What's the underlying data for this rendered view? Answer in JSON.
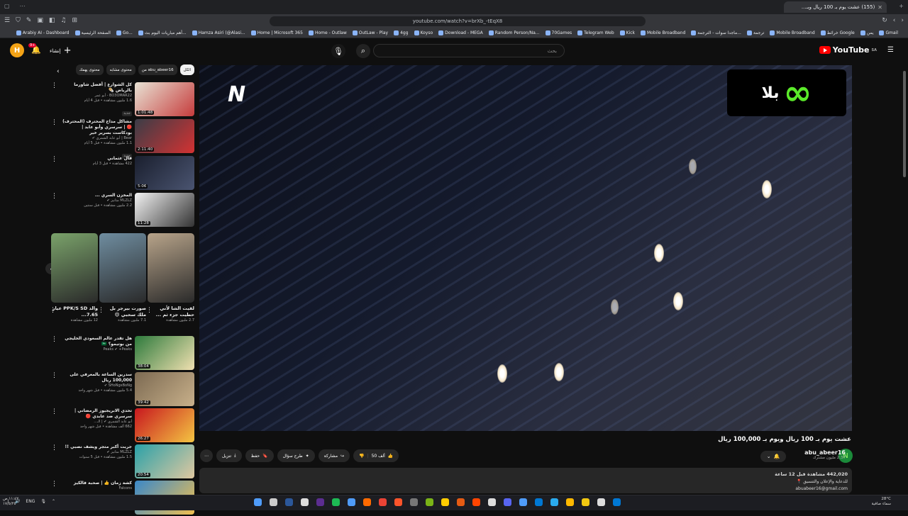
{
  "browser": {
    "tab_title": "(155) عشت يوم بـ 100 ريال وبـ...",
    "url": "youtube.com/watch?v=brXb_-tEqX8",
    "bookmarks": [
      "Gmail",
      "يمن",
      "خرائط Google",
      "Mobile Broadband",
      "ترجمة",
      "ماجدا سوات - الترجمة...",
      "Mobile Broadband",
      "Kick",
      "Telegram Web",
      "70Games",
      "Random Person/Na...",
      "Download - MEGA",
      "Koyso",
      "4gg",
      "OutLaw - Play",
      "Home - Outlaw",
      "Home | Microsoft 365",
      "Hamza Asiri (@Alasi...",
      "أهم مباريات اليوم بث...",
      "Go...",
      "الصفحة الرئيسية",
      "Arabiy AI - Dashboard"
    ]
  },
  "masthead": {
    "logo_text": "YouTube",
    "logo_region": "SA",
    "search_placeholder": "بحث",
    "create_label": "إنشاء",
    "notif_count": "9+",
    "profile_initial": "H"
  },
  "player": {
    "channel_watermark": "∞",
    "channel_watermark_ar": "بلا"
  },
  "video": {
    "title": "عشت يوم بـ 100 ريال ويوم بـ 100,000 ريال",
    "channel": "abu_abeer16",
    "subs": "2.37 مليون مشترك",
    "likes": "50 ألف",
    "share": "مشاركة",
    "ask": "طرح سؤال",
    "save": "حفظ",
    "download": "تنزيل",
    "views_line": "442,020 مشاهدة قبل 12 ساعة",
    "desc_line1": "للدعاية والإعلان والتنسيق 📍",
    "desc_line2": "abuabeer16@gmail.com"
  },
  "chips": [
    "من abu_abeer16",
    "محتوى مشابه",
    "محتوى يهمك"
  ],
  "chip_all": "الكل",
  "sidebar": [
    {
      "title": "كل الشوارع | أفضل شاورما بالرياض 🌯",
      "channel": "BO3OMAR22 - أبو عمر",
      "meta": "1.6 مليون مشاهدة • قبل 4 أيام",
      "badge": "جديد",
      "duration": "1:01:48",
      "color1": "#e8e2d4",
      "color2": "#c63c3c"
    },
    {
      "title": "مشاكل مداح المحترف (المحترف) 🔴 | سرسري وأبو عابد | بودكاست بسرير خير",
      "channel": "Bear | أبو عابد الشمري ✔",
      "meta": "1.1 مليون مشاهدة • قبل 5 أيام",
      "badge": "جديد",
      "duration": "2:11:40",
      "color1": "#3a3d47",
      "color2": "#d43232"
    },
    {
      "title": "قال عثماني",
      "channel": "",
      "meta": "422 مشاهدة • قبل 3 أيام",
      "badge": "",
      "duration": "5:06",
      "color1": "#1a1f2e",
      "color2": "#4a5470"
    },
    {
      "title": "المخزن السري ...",
      "channel": "MLZLZ مثانيز ✔",
      "meta": "2.2 مليون مشاهدة • قبل سنتين",
      "badge": "",
      "duration": "11:28",
      "color1": "#f2f2f2",
      "color2": "#333333"
    }
  ],
  "shorts": [
    {
      "title": "لقيت الشا لأني حطيت جزء ثم ...",
      "meta": "2.7 مليون مشاهدة",
      "color": "#b8a48a"
    },
    {
      "title": "صورت بيرجر بل ملك سحبي 😄",
      "meta": "7.1 مليون مشاهدة",
      "color": "#6f8da0"
    },
    {
      "title": "والد PPK/S SD عيار 7.65...",
      "meta": "12 مليون مشاهدة",
      "color": "#7aa26a"
    }
  ],
  "sidebar2": [
    {
      "title": "هل تقدر عالم السعودي الخليجي من بوتيمو؟ 🇸🇦",
      "channel": "Peaks ✔ +Peaks",
      "meta": "",
      "badge": "",
      "duration": "38:04",
      "color1": "#2d7a3c",
      "color2": "#f0e0b0"
    },
    {
      "title": "سدرين الساعة بالمعرفي على 100,000 ريال",
      "channel": "SHoNgxBoNg ✔",
      "meta": "5.4 مليون مشاهدة • قبل شهر واحد",
      "badge": "",
      "duration": "39:42",
      "color1": "#7c6a52",
      "color2": "#c8b08a"
    },
    {
      "title": "تحدي الابريجيوز الرمضاني | سرسري ضد عابدي 🔴",
      "channel": "أبو عابد الشمري ✔ | الـ...",
      "meta": "662 ألف مشاهدة • قبل شهر واحد",
      "badge": "",
      "duration": "26:27",
      "color1": "#c8171f",
      "color2": "#f4c542"
    },
    {
      "title": "جربت أكبر متجر ويشف نصبي !!",
      "channel": "MLZLZ مثانيز ✔",
      "meta": "1.5 مليون مشاهدة • قبل 5 سنوات",
      "badge": "",
      "duration": "20:54",
      "color1": "#2aa1a8",
      "color2": "#e0c8a0"
    },
    {
      "title": "كشة زمان 👍 | صحبة فالكيز",
      "channel": "Falcons",
      "meta": "",
      "badge": "",
      "duration": "",
      "color1": "#3a88c9",
      "color2": "#f0c050"
    }
  ],
  "taskbar": {
    "lang": "ENG",
    "temp": "28°C",
    "weather": "سماء صافية",
    "time": "١١:٤٢ ص",
    "date": "١٧/٥/٢٥"
  }
}
